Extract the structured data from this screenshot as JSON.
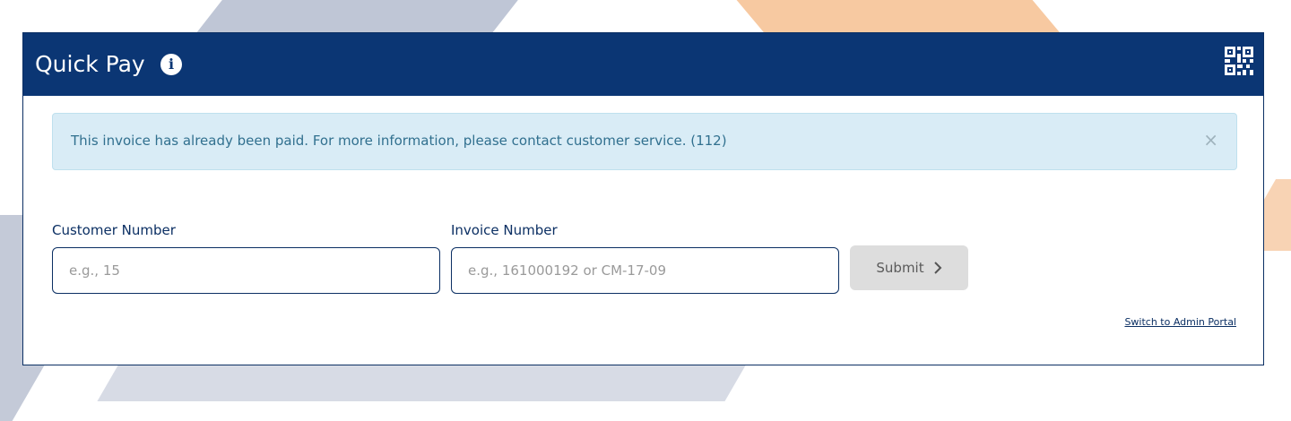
{
  "header": {
    "title": "Quick Pay"
  },
  "alert": {
    "message": "This invoice has already been paid. For more information, please contact customer service. (112)",
    "close_symbol": "×"
  },
  "form": {
    "customer_label": "Customer Number",
    "customer_placeholder": "e.g., 15",
    "invoice_label": "Invoice Number",
    "invoice_placeholder": "e.g., 161000192 or CM-17-09",
    "submit_label": "Submit"
  },
  "footer": {
    "admin_link": "Switch to Admin Portal"
  },
  "icons": {
    "info": "info-icon",
    "qr": "qr-code-icon",
    "close": "close-icon",
    "submit": "chevron-right-icon"
  },
  "colors": {
    "header_bg": "#0b3674",
    "alert_bg": "#d9ecf6",
    "alert_text": "#31708f",
    "button_bg": "#dddddd"
  }
}
